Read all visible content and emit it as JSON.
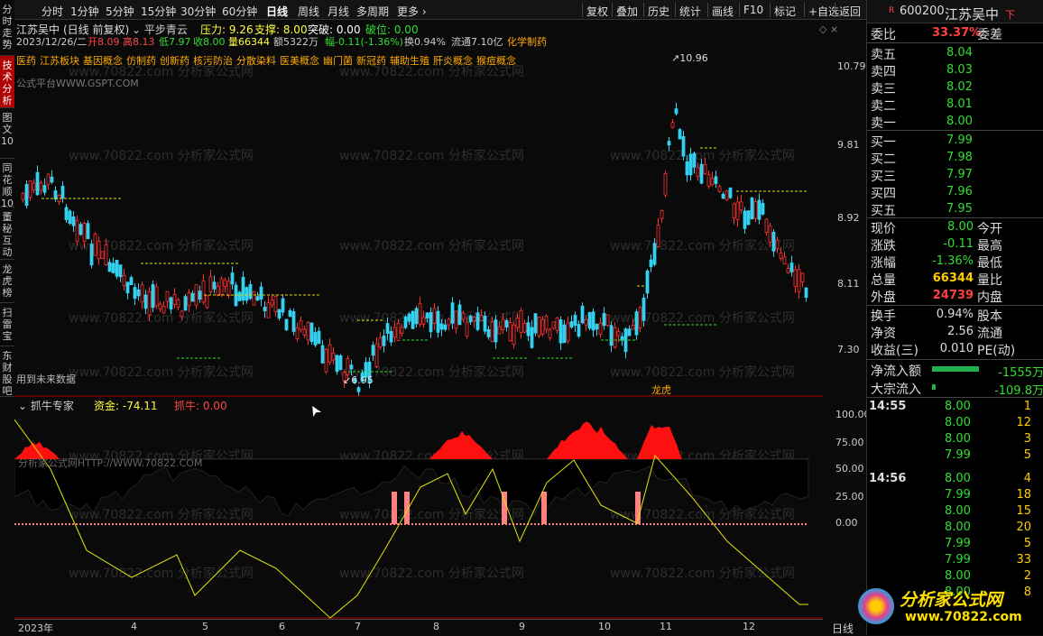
{
  "sidebar": {
    "tabs": [
      "分时走势",
      "技术分析",
      "图文10",
      "同花顺10",
      "董秘互动",
      "龙虎榜",
      "扫雷宝",
      "东财股吧"
    ]
  },
  "toolbar": {
    "left": [
      "分时",
      "1分钟",
      "5分钟",
      "15分钟",
      "30分钟",
      "60分钟",
      "日线",
      "周线",
      "月线",
      "多周期",
      "更多 ›"
    ],
    "active": "日线",
    "right": [
      "复权",
      "叠加",
      "历史",
      "统计",
      "画线",
      "F10",
      "标记",
      "+自选",
      "返回"
    ]
  },
  "stock": {
    "name": "江苏吴中",
    "mode": "(日线 前复权)",
    "indicator": "平步青云",
    "pressure": "9.26",
    "support": "8.00",
    "breakout": "0.00",
    "breakdown": "0.00"
  },
  "ohlc": {
    "date": "2023/12/26/二",
    "open": "开8.09",
    "high": "高8.13",
    "low": "低7.97",
    "close": "收8.00",
    "vol": "量66344",
    "amt": "额5322万",
    "chg": "幅-0.11(-1.36%)",
    "turnover": "换0.94%",
    "float": "流通7.10亿",
    "sector": "化学制药"
  },
  "concepts": [
    "医药",
    "江苏板块",
    "基因概念",
    "仿制药",
    "创新药",
    "核污防治",
    "分散染料",
    "医美概念",
    "幽门菌",
    "新冠药",
    "辅助生殖",
    "肝炎概念",
    "猴痘概念"
  ],
  "watermark1": "公式平台WWW.GSPT.COM",
  "watermark2": "www.70822.com 分析家公式网",
  "future_note": "用到未来数据",
  "price_axis": [
    "10.79",
    "9.81",
    "8.92",
    "8.11",
    "7.30"
  ],
  "high_label": "10.96",
  "low_label": "6.95",
  "lhb": "龙虎",
  "sub": {
    "name": "抓牛专家",
    "fund": "资金: -74.11",
    "bull": "抓牛: 0.00",
    "axis": [
      "100.00",
      "75.00",
      "50.00",
      "25.00",
      "0.00"
    ],
    "wm": "分析家公式网HTTP://WWW.70822.COM"
  },
  "x_axis": [
    "2023年",
    "4",
    "5",
    "6",
    "7",
    "8",
    "9",
    "10",
    "11",
    "12"
  ],
  "period": "日线",
  "quote": {
    "code": "600200",
    "name": "江苏吴中",
    "wb_label": "委比",
    "wb": "33.37%",
    "wc_label": "委差",
    "asks": [
      [
        "卖五",
        "8.04"
      ],
      [
        "卖四",
        "8.03"
      ],
      [
        "卖三",
        "8.02"
      ],
      [
        "卖二",
        "8.01"
      ],
      [
        "卖一",
        "8.00"
      ]
    ],
    "bids": [
      [
        "买一",
        "7.99"
      ],
      [
        "买二",
        "7.98"
      ],
      [
        "买三",
        "7.97"
      ],
      [
        "买四",
        "7.96"
      ],
      [
        "买五",
        "7.95"
      ]
    ],
    "stats": [
      [
        "现价",
        "8.00",
        "今开"
      ],
      [
        "涨跌",
        "-0.11",
        "最高"
      ],
      [
        "涨幅",
        "-1.36%",
        "最低"
      ],
      [
        "总量",
        "66344",
        "量比"
      ],
      [
        "外盘",
        "24739",
        "内盘"
      ]
    ],
    "stats2": [
      [
        "换手",
        "0.94%",
        "股本"
      ],
      [
        "净资",
        "2.56",
        "流通"
      ],
      [
        "收益(三)",
        "0.010",
        "PE(动)"
      ]
    ],
    "flow": [
      [
        "净流入额",
        "-1555万"
      ],
      [
        "大宗流入",
        "-109.8万"
      ]
    ],
    "ticks": [
      [
        "14:55",
        "8.00",
        "1"
      ],
      [
        "",
        "8.00",
        "12"
      ],
      [
        "",
        "8.00",
        "3"
      ],
      [
        "",
        "7.99",
        "5"
      ],
      [
        "14:56",
        "8.00",
        "4"
      ],
      [
        "",
        "7.99",
        "18"
      ],
      [
        "",
        "8.00",
        "15"
      ],
      [
        "",
        "8.00",
        "20"
      ],
      [
        "",
        "7.99",
        "5"
      ],
      [
        "",
        "7.99",
        "33"
      ],
      [
        "",
        "8.00",
        "2"
      ],
      [
        "",
        "8.00",
        "8"
      ]
    ]
  },
  "logo": {
    "title": "分析家公式网",
    "url": "www.70822.com"
  }
}
